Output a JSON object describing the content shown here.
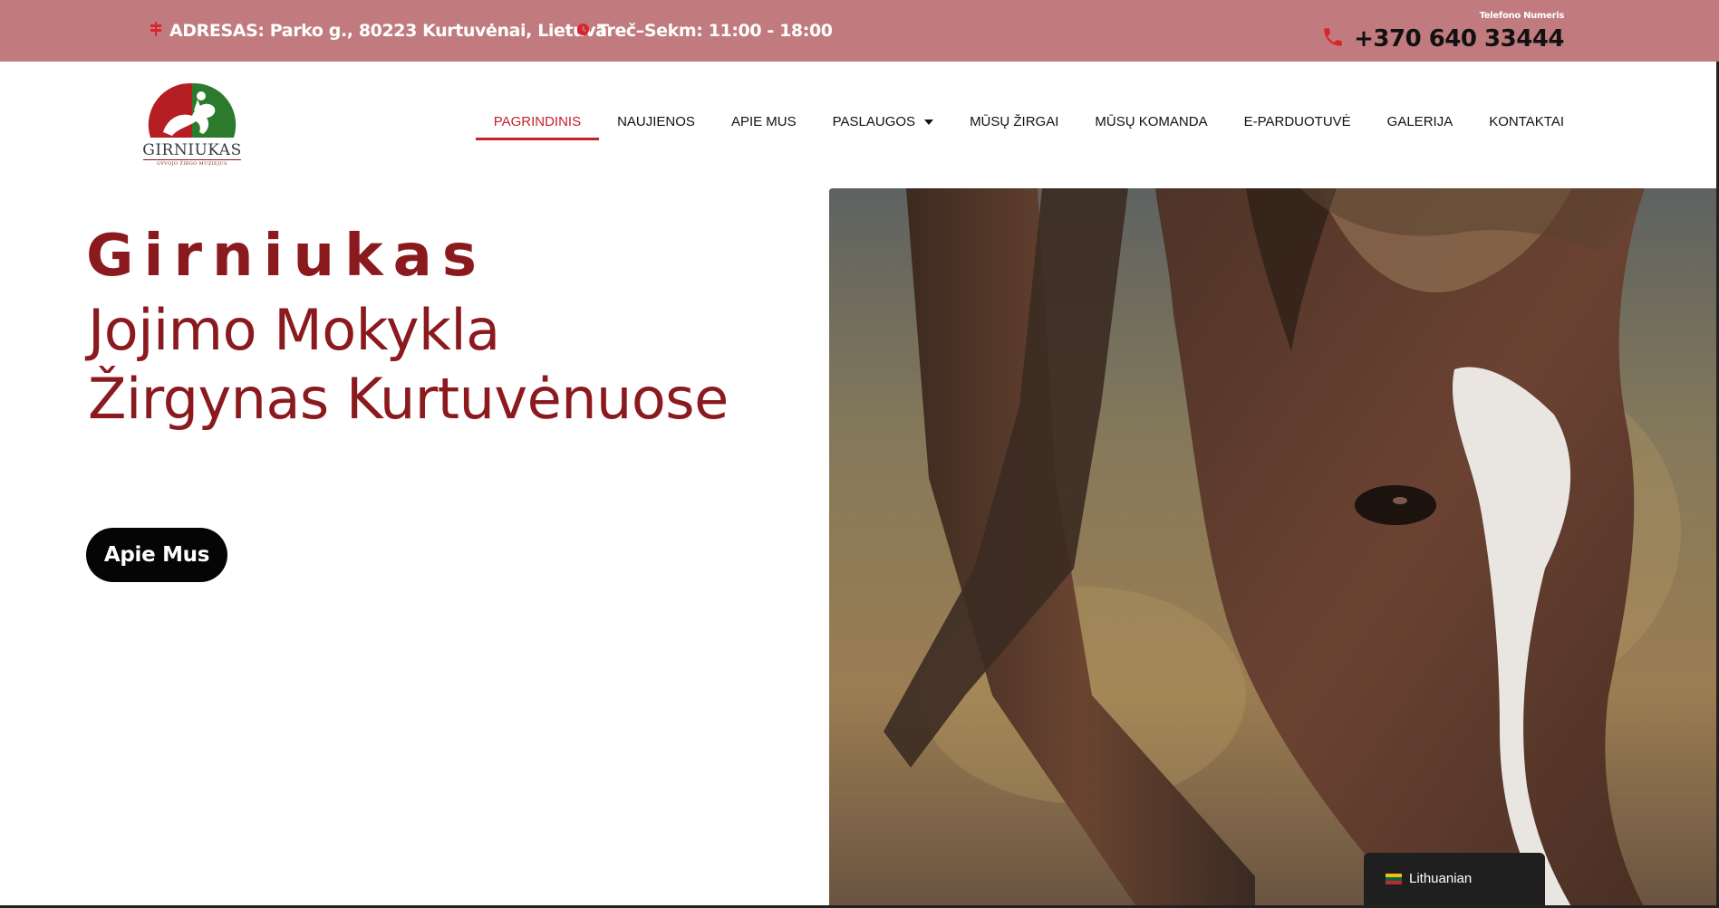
{
  "topbar": {
    "address_icon": "signpost-icon",
    "address": "ADRESAS: Parko g., 80223 Kurtuvėnai, Lietuva",
    "hours_icon": "clock-icon",
    "hours": "Treč–Sekm: 11:00 - 18:00",
    "phone_caption": "Telefono Numeris",
    "phone_icon": "phone-icon",
    "phone": "+370 640 33444"
  },
  "logo": {
    "name": "GIRNIUKAS",
    "subtitle": "GYVOJO ŽIRGO MUZIEJUS"
  },
  "nav": {
    "items": [
      {
        "label": "PAGRINDINIS",
        "active": true
      },
      {
        "label": "NAUJIENOS"
      },
      {
        "label": "APIE MUS"
      },
      {
        "label": "PASLAUGOS",
        "dropdown": true
      },
      {
        "label": "MŪSŲ ŽIRGAI"
      },
      {
        "label": "MŪSŲ KOMANDA"
      },
      {
        "label": "E-PARDUOTUVĖ"
      },
      {
        "label": "GALERIJA"
      },
      {
        "label": "KONTAKTAI"
      }
    ]
  },
  "hero": {
    "title": "Girniukas",
    "subtitle_line1": "Jojimo Mokykla",
    "subtitle_line2": "Žirgynas Kurtuvėnuose",
    "button_label": "Apie Mus"
  },
  "language": {
    "label": "Lithuanian",
    "flag_icon": "lithuania-flag-icon"
  },
  "colors": {
    "topbar_bg": "#c17b7e",
    "accent_red": "#c6202b",
    "hero_text": "#8b1a1f",
    "button_bg": "#050505"
  }
}
